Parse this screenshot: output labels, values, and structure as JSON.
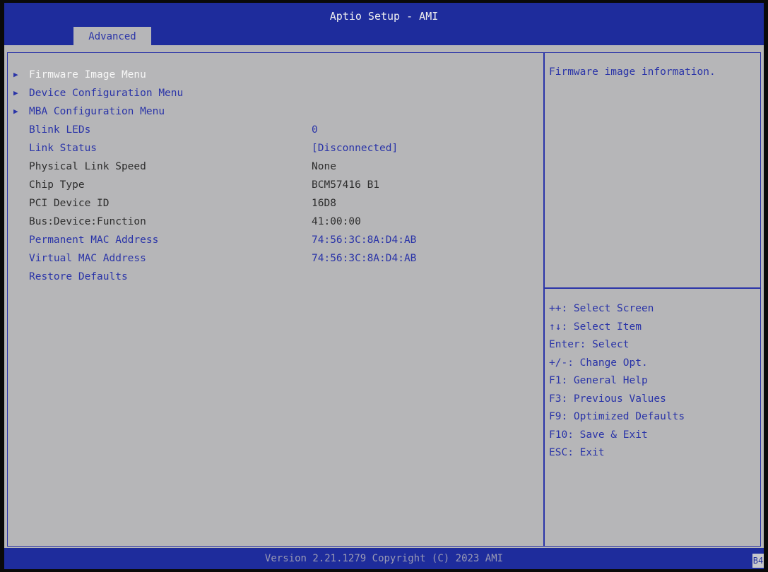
{
  "header": {
    "title": "Aptio Setup - AMI",
    "tabs": [
      {
        "label": "Advanced"
      }
    ]
  },
  "menu": {
    "items": [
      {
        "label": "Firmware Image Menu",
        "value": "",
        "submenu": true,
        "selected": true
      },
      {
        "label": "Device Configuration Menu",
        "value": "",
        "submenu": true
      },
      {
        "label": "MBA Configuration Menu",
        "value": "",
        "submenu": true
      },
      {
        "label": "Blink LEDs",
        "value": "0",
        "editable": true
      },
      {
        "label": "Link Status",
        "value": "[Disconnected]",
        "editable": true
      },
      {
        "label": "Physical Link Speed",
        "value": "None",
        "editable": false
      },
      {
        "label": "Chip Type",
        "value": "BCM57416 B1",
        "editable": false
      },
      {
        "label": "PCI Device ID",
        "value": "16D8",
        "editable": false
      },
      {
        "label": "Bus:Device:Function",
        "value": "41:00:00",
        "editable": false
      },
      {
        "label": "Permanent MAC Address",
        "value": "74:56:3C:8A:D4:AB",
        "editable": true
      },
      {
        "label": "Virtual MAC Address",
        "value": "74:56:3C:8A:D4:AB",
        "editable": true
      },
      {
        "label": "Restore Defaults",
        "value": "",
        "editable": true
      }
    ]
  },
  "help": {
    "text": "Firmware image information."
  },
  "keys": [
    "++: Select Screen",
    "↑↓: Select Item",
    "Enter: Select",
    "+/-: Change Opt.",
    "F1: General Help",
    "F3: Previous Values",
    "F9: Optimized Defaults",
    "F10: Save & Exit",
    "ESC: Exit"
  ],
  "footer": {
    "text": "Version 2.21.1279 Copyright (C) 2023 AMI",
    "badge": "B4"
  },
  "colors": {
    "header_bg": "#1e2c9c",
    "screen_bg": "#b6b6b8",
    "accent_blue": "#2a34a8",
    "selected_text": "#f6f6f6"
  }
}
